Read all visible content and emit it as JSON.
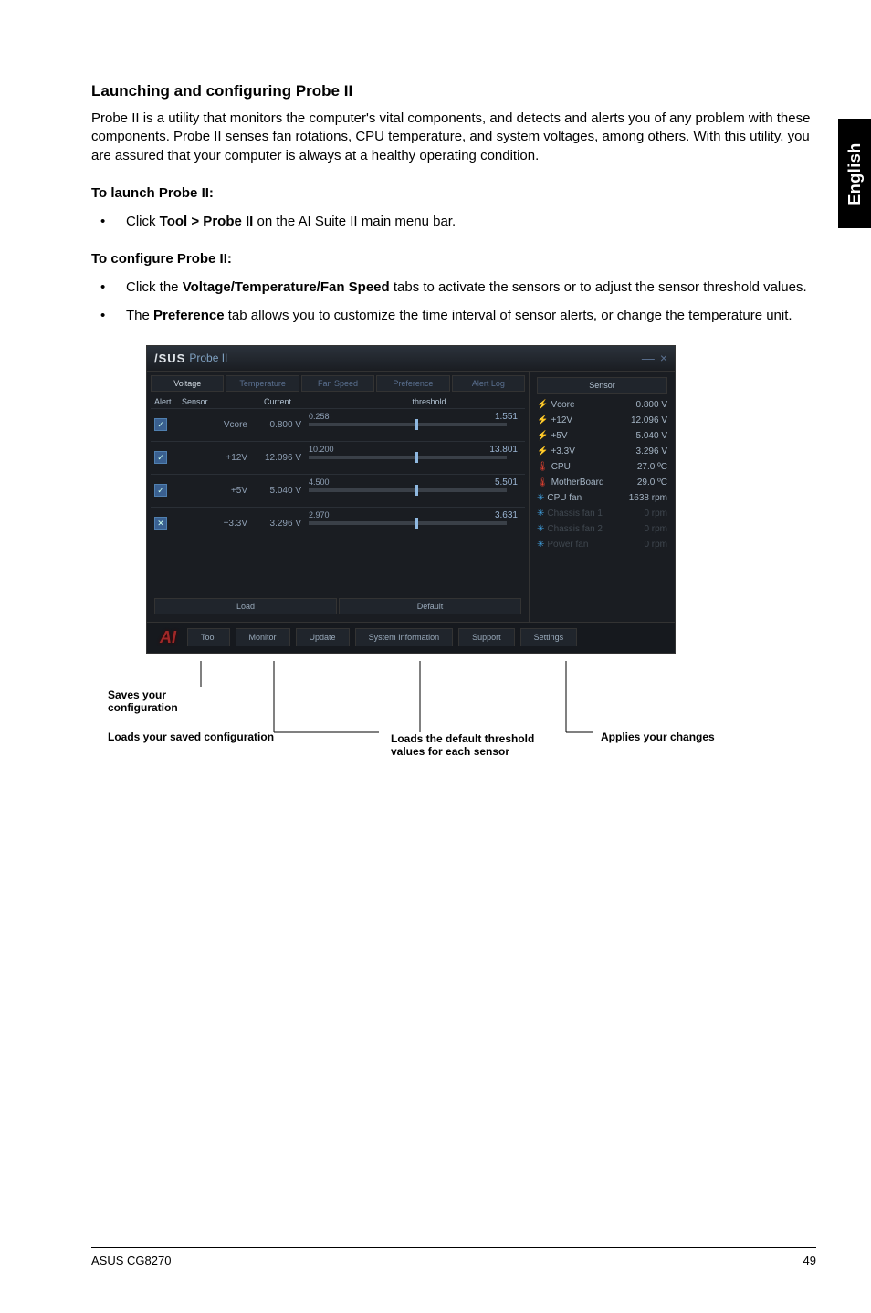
{
  "sideTab": "English",
  "heading": "Launching and configuring Probe II",
  "intro": "Probe II is a utility that monitors the computer's vital components, and detects and alerts you of any problem with these components. Probe II senses fan rotations, CPU temperature, and system voltages, among others. With this utility, you are assured that your computer is always at a healthy operating condition.",
  "launchTitle": "To launch Probe II:",
  "launchBullet_pre": "Click ",
  "launchBullet_bold": "Tool > Probe II",
  "launchBullet_post": " on the AI Suite II main menu bar.",
  "configTitle": "To configure Probe II:",
  "configBullet1_pre": "Click the ",
  "configBullet1_bold": "Voltage/Temperature/Fan Speed",
  "configBullet1_post": " tabs to activate the sensors or to adjust the sensor threshold values.",
  "configBullet2_pre": "The ",
  "configBullet2_bold": "Preference",
  "configBullet2_post": " tab allows you to customize the time interval of sensor alerts, or change the temperature unit.",
  "window": {
    "brand": "/SUS",
    "title": "Probe II",
    "minimize": "—",
    "close": "×",
    "tabs": {
      "voltage": "Voltage",
      "temperature": "Temperature",
      "fanspeed": "Fan Speed",
      "preference": "Preference",
      "alertlog": "Alert Log"
    },
    "colHeaders": {
      "alert": "Alert",
      "sensor": "Sensor",
      "current": "Current",
      "threshold": "threshold"
    },
    "sensors": [
      {
        "name": "Vcore",
        "current": "0.800 V",
        "low": "0.258",
        "high": "1.551",
        "on": true
      },
      {
        "name": "+12V",
        "current": "12.096 V",
        "low": "10.200",
        "high": "13.801",
        "on": true
      },
      {
        "name": "+5V",
        "current": "5.040 V",
        "low": "4.500",
        "high": "5.501",
        "on": true
      },
      {
        "name": "+3.3V",
        "current": "3.296 V",
        "low": "2.970",
        "high": "3.631",
        "on": false
      }
    ],
    "loadBtn": "Load",
    "defaultBtn": "Default",
    "sensorPanelTitle": "Sensor",
    "stats": [
      {
        "icon": "bolt",
        "label": "Vcore",
        "value": "0.800 V"
      },
      {
        "icon": "bolt",
        "label": "+12V",
        "value": "12.096 V"
      },
      {
        "icon": "bolt",
        "label": "+5V",
        "value": "5.040 V"
      },
      {
        "icon": "bolt",
        "label": "+3.3V",
        "value": "3.296 V"
      },
      {
        "icon": "therm",
        "label": "CPU",
        "value": "27.0 ºC"
      },
      {
        "icon": "therm",
        "label": "MotherBoard",
        "value": "29.0 ºC"
      },
      {
        "icon": "fan",
        "label": "CPU fan",
        "value": "1638 rpm"
      }
    ],
    "footerBtns": {
      "tool": "Tool",
      "monitor": "Monitor",
      "update": "Update",
      "sysinfo": "System Information",
      "support": "Support",
      "settings": "Settings"
    }
  },
  "callouts": {
    "saves": "Saves your configuration",
    "loads": "Loads your saved configuration",
    "default": "Loads the default threshold values for each sensor",
    "apply": "Applies your changes"
  },
  "footerLeft": "ASUS CG8270",
  "footerRight": "49"
}
